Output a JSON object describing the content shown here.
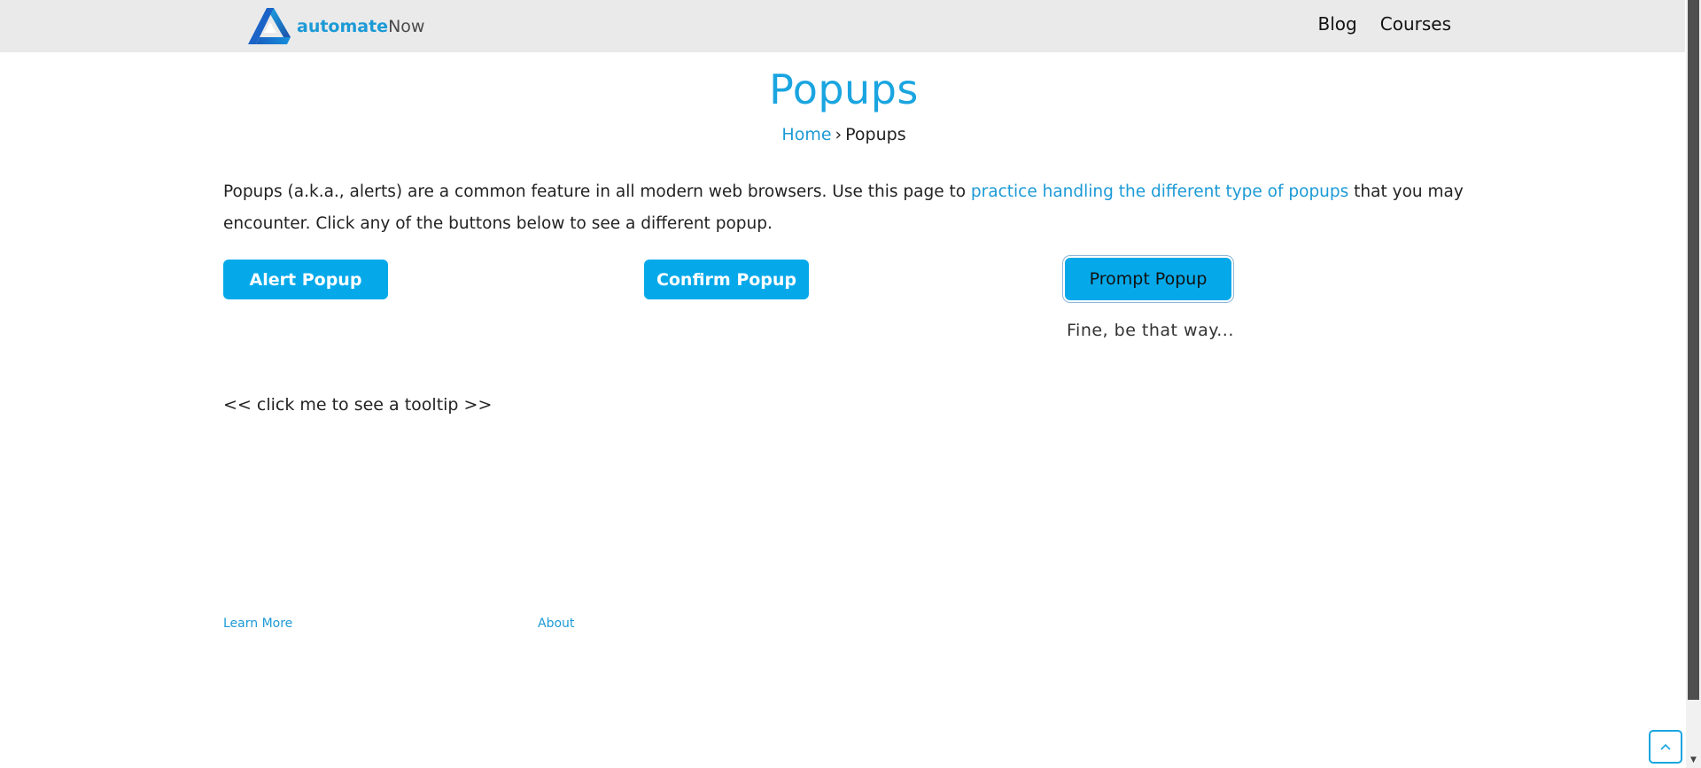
{
  "header": {
    "logo": {
      "bold_text": "automate",
      "light_text": "Now",
      "icon": "automatenow-logo-icon"
    },
    "nav": {
      "blog": "Blog",
      "courses": "Courses"
    }
  },
  "main": {
    "title": "Popups",
    "breadcrumb": {
      "home": "Home",
      "separator": "›",
      "current": "Popups"
    },
    "intro": {
      "before_link": "Popups (a.k.a., alerts) are a common feature in all modern web browsers. Use this page to ",
      "link_text": "practice handling the different type of popups",
      "after_link": " that you may encounter. Click any of the buttons below to see a different popup."
    },
    "buttons": {
      "alert": "Alert Popup",
      "confirm": "Confirm Popup",
      "prompt": "Prompt Popup"
    },
    "prompt_result": "Fine, be that way...",
    "tooltip_trigger": "<< click me to see a tooltip >>"
  },
  "footer": {
    "learn_more": "Learn More",
    "about": "About"
  },
  "widgets": {
    "back_to_top_icon": "chevron-up-icon",
    "scroll_down_icon": "triangle-down-icon"
  },
  "colors": {
    "accent": "#1aa5e0",
    "button": "#05a9ea",
    "header_bg": "#eaeaea"
  }
}
